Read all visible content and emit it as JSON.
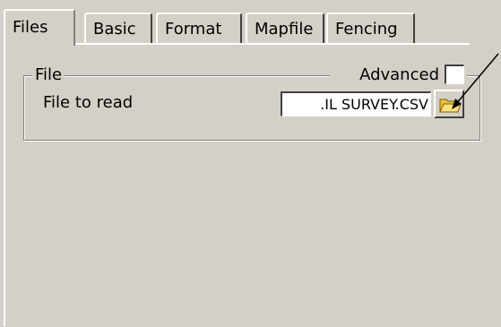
{
  "tabs": [
    {
      "label": "Files",
      "active": true
    },
    {
      "label": "Basic",
      "active": false
    },
    {
      "label": "Format",
      "active": false
    },
    {
      "label": "Mapfile",
      "active": false
    },
    {
      "label": "Fencing",
      "active": false
    }
  ],
  "file_group": {
    "legend": "File",
    "advanced_label": "Advanced",
    "advanced_checked": false,
    "file_label": "File to read",
    "file_value": ".IL SURVEY.CSV",
    "browse_icon": "folder-icon"
  },
  "colors": {
    "dialog_background": "#d4d0c8",
    "folder_icon": "#f0c040"
  }
}
